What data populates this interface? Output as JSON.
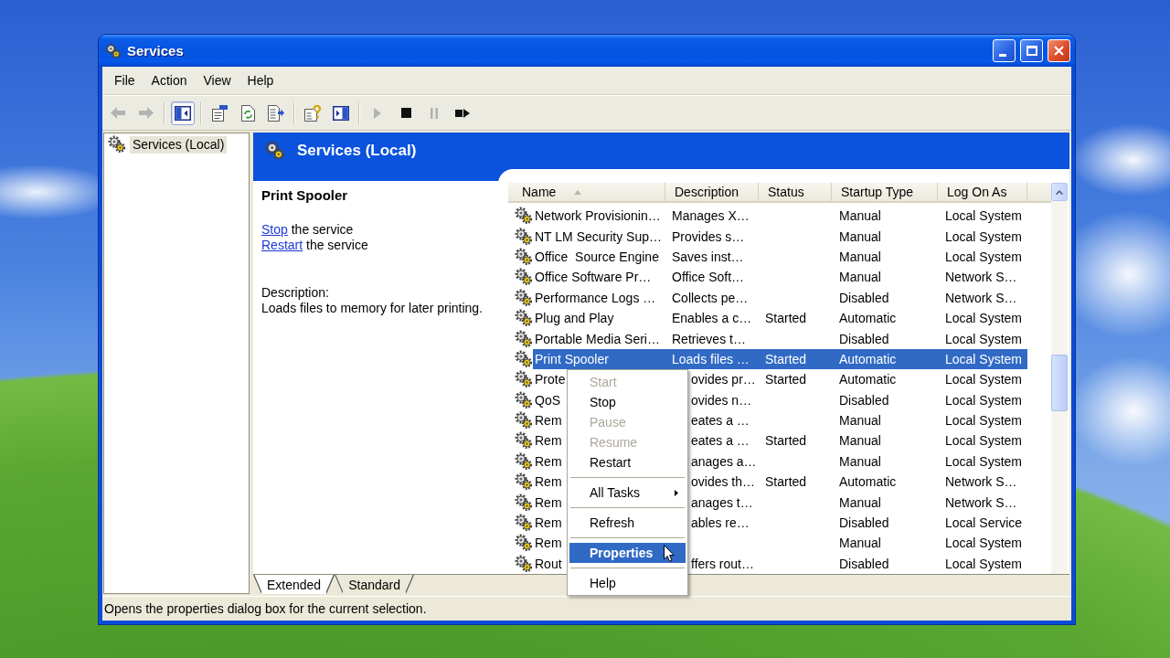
{
  "window": {
    "title": "Services"
  },
  "menu_bar": [
    "File",
    "Action",
    "View",
    "Help"
  ],
  "toolbar_groups": [
    [
      {
        "kind": "back",
        "disabled": true,
        "pressed": false
      },
      {
        "kind": "forward",
        "disabled": true,
        "pressed": false
      }
    ],
    [
      {
        "kind": "console-tree",
        "disabled": false,
        "pressed": true
      }
    ],
    [
      {
        "kind": "properties",
        "disabled": false,
        "pressed": false
      },
      {
        "kind": "refresh",
        "disabled": false,
        "pressed": false
      },
      {
        "kind": "export",
        "disabled": false,
        "pressed": false
      }
    ],
    [
      {
        "kind": "help",
        "disabled": false,
        "pressed": false
      },
      {
        "kind": "action-pane",
        "disabled": false,
        "pressed": false
      }
    ],
    [
      {
        "kind": "start",
        "disabled": true,
        "pressed": false
      },
      {
        "kind": "stop",
        "disabled": false,
        "pressed": false
      },
      {
        "kind": "pause",
        "disabled": true,
        "pressed": false
      },
      {
        "kind": "restart",
        "disabled": false,
        "pressed": false
      }
    ]
  ],
  "tree": [
    {
      "label": "Services (Local)",
      "selected": true
    }
  ],
  "pane": {
    "title": "Services (Local)"
  },
  "details": {
    "title": "Print Spooler",
    "actions": [
      {
        "link": "Stop",
        "text": "the service"
      },
      {
        "link": "Restart",
        "text": "the service"
      }
    ],
    "description_label": "Description:",
    "description": "Loads files to memory for later printing."
  },
  "table": {
    "columns": [
      {
        "label": "Name",
        "sorted": true
      },
      {
        "label": "Description",
        "sorted": false
      },
      {
        "label": "Status",
        "sorted": false
      },
      {
        "label": "Startup Type",
        "sorted": false
      },
      {
        "label": "Log On As",
        "sorted": false
      }
    ],
    "rows": [
      {
        "kind": "full",
        "selected": false,
        "name": "Network Provisionin…",
        "description": "Manages X…",
        "startup_type": "Manual",
        "log_on_as": "Local System"
      },
      {
        "kind": "full",
        "selected": false,
        "name": "NT LM Security Sup…",
        "description": "Provides s…",
        "startup_type": "Manual",
        "log_on_as": "Local System"
      },
      {
        "kind": "full",
        "selected": false,
        "name": "Office  Source Engine",
        "description": "Saves inst…",
        "startup_type": "Manual",
        "log_on_as": "Local System"
      },
      {
        "kind": "full",
        "selected": false,
        "name": "Office Software Pr…",
        "description": "Office Soft…",
        "startup_type": "Manual",
        "log_on_as": "Network S…"
      },
      {
        "kind": "full",
        "selected": false,
        "name": "Performance Logs …",
        "description": "Collects pe…",
        "startup_type": "Disabled",
        "log_on_as": "Network S…"
      },
      {
        "kind": "full",
        "selected": false,
        "name": "Plug and Play",
        "description": "Enables a c…",
        "status": "Started",
        "startup_type": "Automatic",
        "log_on_as": "Local System"
      },
      {
        "kind": "full",
        "selected": false,
        "name": "Portable Media Seri…",
        "description": "Retrieves t…",
        "startup_type": "Disabled",
        "log_on_as": "Local System"
      },
      {
        "kind": "full",
        "selected": true,
        "name": "Print Spooler",
        "description": "Loads files …",
        "status": "Started",
        "startup_type": "Automatic",
        "log_on_as": "Local System"
      },
      {
        "kind": "under-menu",
        "selected": false,
        "name": "Prote",
        "description": "ovides pr…",
        "status": "Started",
        "startup_type": "Automatic",
        "log_on_as": "Local System"
      },
      {
        "kind": "under-menu",
        "selected": false,
        "name": "QoS",
        "description": "ovides n…",
        "startup_type": "Disabled",
        "log_on_as": "Local System"
      },
      {
        "kind": "under-menu",
        "selected": false,
        "name": "Rem",
        "description": "eates a …",
        "startup_type": "Manual",
        "log_on_as": "Local System"
      },
      {
        "kind": "under-menu",
        "selected": false,
        "name": "Rem",
        "description": "eates a …",
        "status": "Started",
        "startup_type": "Manual",
        "log_on_as": "Local System"
      },
      {
        "kind": "under-menu",
        "selected": false,
        "name": "Rem",
        "description": "anages a…",
        "startup_type": "Manual",
        "log_on_as": "Local System"
      },
      {
        "kind": "under-menu",
        "selected": false,
        "name": "Rem",
        "description": "ovides th…",
        "status": "Started",
        "startup_type": "Automatic",
        "log_on_as": "Network S…"
      },
      {
        "kind": "under-menu",
        "selected": false,
        "name": "Rem",
        "description": "anages t…",
        "startup_type": "Manual",
        "log_on_as": "Network S…"
      },
      {
        "kind": "under-menu",
        "selected": false,
        "name": "Rem",
        "description": "ables re…",
        "startup_type": "Disabled",
        "log_on_as": "Local Service"
      },
      {
        "kind": "under-menu",
        "selected": false,
        "name": "Rem",
        "startup_type": "Manual",
        "log_on_as": "Local System"
      },
      {
        "kind": "under-menu",
        "selected": false,
        "name": "Rout",
        "description": "ffers rout…",
        "startup_type": "Disabled",
        "log_on_as": "Local System"
      }
    ]
  },
  "context_menu": {
    "groups": [
      [
        {
          "label": "Start",
          "disabled": true,
          "selected": false,
          "default": false,
          "submenu": false
        },
        {
          "label": "Stop",
          "disabled": false,
          "selected": false,
          "default": false,
          "submenu": false
        },
        {
          "label": "Pause",
          "disabled": true,
          "selected": false,
          "default": false,
          "submenu": false
        },
        {
          "label": "Resume",
          "disabled": true,
          "selected": false,
          "default": false,
          "submenu": false
        },
        {
          "label": "Restart",
          "disabled": false,
          "selected": false,
          "default": false,
          "submenu": false
        }
      ],
      [
        {
          "label": "All Tasks",
          "disabled": false,
          "selected": false,
          "default": false,
          "submenu": true
        }
      ],
      [
        {
          "label": "Refresh",
          "disabled": false,
          "selected": false,
          "default": false,
          "submenu": false
        }
      ],
      [
        {
          "label": "Properties",
          "disabled": false,
          "selected": true,
          "default": true,
          "submenu": false
        }
      ],
      [
        {
          "label": "Help",
          "disabled": false,
          "selected": false,
          "default": false,
          "submenu": false
        }
      ]
    ]
  },
  "view_tabs": [
    {
      "label": "Extended",
      "selected": true
    },
    {
      "label": "Standard",
      "selected": false
    }
  ],
  "status_bar": {
    "text": "Opens the properties dialog box for the current selection."
  }
}
